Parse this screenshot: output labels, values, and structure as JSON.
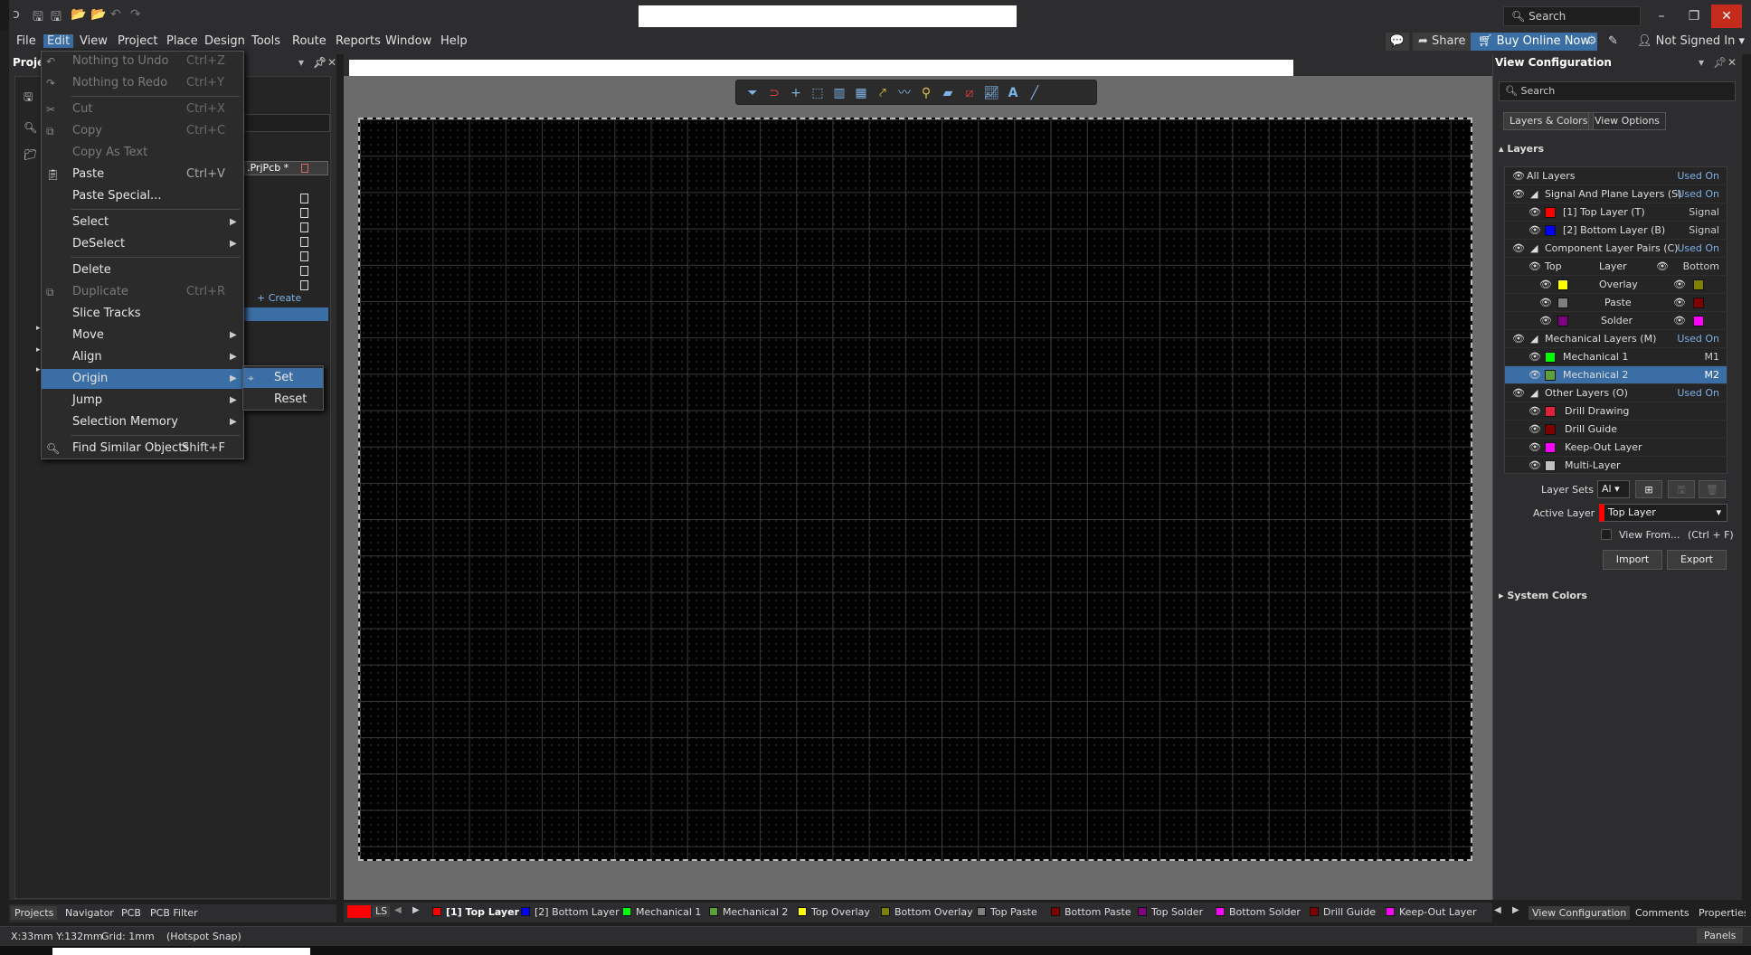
{
  "titlebar": {
    "search_placeholder": "Search",
    "minimize": "–",
    "restore": "❐",
    "close": "✕"
  },
  "menubar": {
    "items": [
      "File",
      "Edit",
      "View",
      "Project",
      "Place",
      "Design",
      "Tools",
      "Route",
      "Reports",
      "Window",
      "Help"
    ],
    "share": "Share",
    "buy": "Buy Online Now",
    "user": "Not Signed In"
  },
  "left_panel": {
    "title": "Proje",
    "project_file": ".PrjPcb *",
    "create": "+ Create"
  },
  "edit_menu": {
    "items": [
      {
        "label": "Nothing to Undo",
        "shortcut": "Ctrl+Z",
        "disabled": true
      },
      {
        "label": "Nothing to Redo",
        "shortcut": "Ctrl+Y",
        "disabled": true
      },
      {
        "label": "Cut",
        "shortcut": "Ctrl+X",
        "disabled": true
      },
      {
        "label": "Copy",
        "shortcut": "Ctrl+C",
        "disabled": true
      },
      {
        "label": "Copy As Text",
        "shortcut": "",
        "disabled": true
      },
      {
        "label": "Paste",
        "shortcut": "Ctrl+V"
      },
      {
        "label": "Paste Special...",
        "shortcut": ""
      },
      {
        "label": "Select",
        "shortcut": ""
      },
      {
        "label": "DeSelect",
        "shortcut": ""
      },
      {
        "label": "Delete",
        "shortcut": ""
      },
      {
        "label": "Duplicate",
        "shortcut": "Ctrl+R",
        "disabled": true
      },
      {
        "label": "Slice Tracks",
        "shortcut": ""
      },
      {
        "label": "Move",
        "shortcut": ""
      },
      {
        "label": "Align",
        "shortcut": ""
      },
      {
        "label": "Origin",
        "shortcut": ""
      },
      {
        "label": "Jump",
        "shortcut": ""
      },
      {
        "label": "Selection Memory",
        "shortcut": ""
      },
      {
        "label": "Find Similar Objects",
        "shortcut": "Shift+F"
      }
    ],
    "submenu": [
      "Set",
      "Reset"
    ]
  },
  "view_config": {
    "title": "View Configuration",
    "search_placeholder": "Search",
    "tabs": [
      "Layers & Colors",
      "View Options"
    ],
    "layers_header": "Layers",
    "rows": [
      {
        "name": "All Layers",
        "right": "Used On",
        "right_blue": true
      },
      {
        "name": "Signal And Plane Layers (S)",
        "right": "Used On",
        "right_blue": true
      },
      {
        "name": "[1] Top Layer (T)",
        "right": "Signal",
        "color": "#ff0000"
      },
      {
        "name": "[2] Bottom Layer (B)",
        "right": "Signal",
        "color": "#0000ff"
      },
      {
        "name": "Component Layer Pairs (C)",
        "right": "Used On",
        "right_blue": true
      },
      {
        "name": "Layer",
        "left": "Top",
        "right": "Bottom"
      },
      {
        "name": "Overlay",
        "color": "#ffff00",
        "color2": "#808000"
      },
      {
        "name": "Paste",
        "color": "#808080",
        "color2": "#800000"
      },
      {
        "name": "Solder",
        "color": "#800080",
        "color2": "#ff00ff"
      },
      {
        "name": "Mechanical Layers (M)",
        "right": "Used On",
        "right_blue": true
      },
      {
        "name": "Mechanical 1",
        "right": "M1",
        "color": "#00ff00"
      },
      {
        "name": "Mechanical 2",
        "right": "M2",
        "color": "#5ba03a"
      },
      {
        "name": "Other Layers (O)",
        "right": "Used On",
        "right_blue": true
      },
      {
        "name": "Drill Drawing",
        "color": "#e0203a"
      },
      {
        "name": "Drill Guide",
        "color": "#800000"
      },
      {
        "name": "Keep-Out Layer",
        "color": "#ff00ff"
      },
      {
        "name": "Multi-Layer",
        "color": "#c0c0c0"
      }
    ],
    "layer_sets_label": "Layer Sets",
    "layer_sets_value": "Al",
    "active_layer_label": "Active Layer",
    "active_layer_value": "Top Layer",
    "view_from": "View From...",
    "view_from_shortcut": "(Ctrl + F)",
    "import": "Import",
    "export": "Export",
    "system_colors": "System Colors"
  },
  "bottom": {
    "left_tabs": [
      "Projects",
      "Navigator",
      "PCB",
      "PCB Filter"
    ],
    "ls": "LS",
    "layer_tabs": [
      {
        "label": "[1] Top Layer",
        "color": "#ff0000"
      },
      {
        "label": "[2] Bottom Layer",
        "color": "#0000ff"
      },
      {
        "label": "Mechanical 1",
        "color": "#00ff00"
      },
      {
        "label": "Mechanical 2",
        "color": "#5ba03a"
      },
      {
        "label": "Top Overlay",
        "color": "#ffff00"
      },
      {
        "label": "Bottom Overlay",
        "color": "#808000"
      },
      {
        "label": "Top Paste",
        "color": "#808080"
      },
      {
        "label": "Bottom Paste",
        "color": "#800000"
      },
      {
        "label": "Top Solder",
        "color": "#800080"
      },
      {
        "label": "Bottom Solder",
        "color": "#ff00ff"
      },
      {
        "label": "Drill Guide",
        "color": "#800000"
      },
      {
        "label": "Keep-Out Layer",
        "color": "#ff00ff"
      }
    ],
    "right_tabs": [
      "View Configuration",
      "Comments",
      "Properties"
    ]
  },
  "status": {
    "coords": "X:33mm Y:132mm",
    "grid": "Grid: 1mm",
    "snap": "(Hotspot Snap)",
    "panels": "Panels"
  }
}
